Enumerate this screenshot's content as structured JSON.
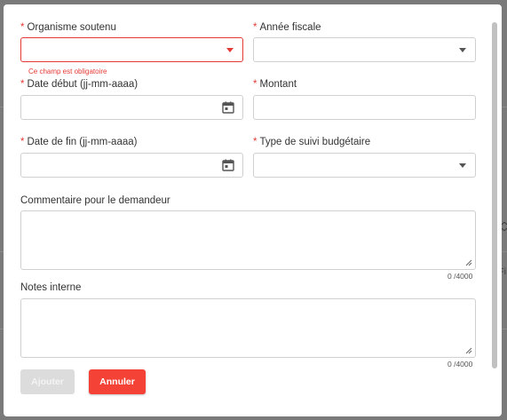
{
  "backdrop": {
    "edge_text_1": "",
    "edge_text_2": "Fi"
  },
  "form": {
    "organisme": {
      "label": "Organisme soutenu",
      "required": "*",
      "error": "Ce champ est obligatoire",
      "value": ""
    },
    "annee": {
      "label": "Année fiscale",
      "required": "*",
      "value": ""
    },
    "date_debut": {
      "label": "Date début (jj-mm-aaaa)",
      "required": "*",
      "value": ""
    },
    "montant": {
      "label": "Montant",
      "required": "*",
      "value": ""
    },
    "date_fin": {
      "label": "Date de fin (jj-mm-aaaa)",
      "required": "*",
      "value": ""
    },
    "type_suivi": {
      "label": "Type de suivi budgétaire",
      "required": "*",
      "value": ""
    },
    "commentaire": {
      "label": "Commentaire pour le demandeur",
      "value": "",
      "counter": "0 /4000"
    },
    "notes": {
      "label": "Notes interne",
      "value": "",
      "counter": "0 /4000"
    }
  },
  "actions": {
    "add_label": "Ajouter",
    "cancel_label": "Annuler"
  },
  "icons": {
    "calendar": "calendar-icon",
    "dropdown": "chevron-down-icon"
  },
  "colors": {
    "error": "#e53935",
    "cancel_button": "#f44336",
    "disabled_button": "#dcdcdc"
  }
}
